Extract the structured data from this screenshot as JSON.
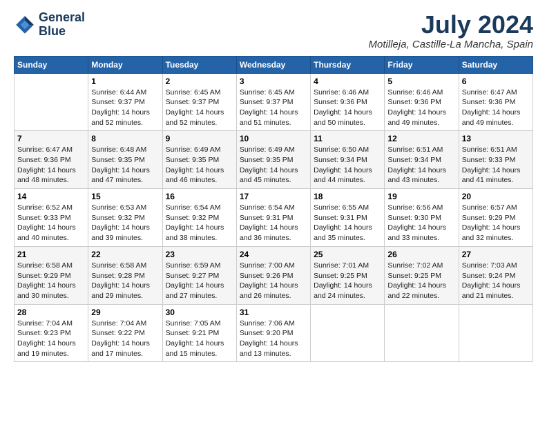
{
  "logo": {
    "line1": "General",
    "line2": "Blue"
  },
  "title": "July 2024",
  "subtitle": "Motilleja, Castille-La Mancha, Spain",
  "weekdays": [
    "Sunday",
    "Monday",
    "Tuesday",
    "Wednesday",
    "Thursday",
    "Friday",
    "Saturday"
  ],
  "weeks": [
    [
      {
        "day": "",
        "sunrise": "",
        "sunset": "",
        "daylight": ""
      },
      {
        "day": "1",
        "sunrise": "Sunrise: 6:44 AM",
        "sunset": "Sunset: 9:37 PM",
        "daylight": "Daylight: 14 hours and 52 minutes."
      },
      {
        "day": "2",
        "sunrise": "Sunrise: 6:45 AM",
        "sunset": "Sunset: 9:37 PM",
        "daylight": "Daylight: 14 hours and 52 minutes."
      },
      {
        "day": "3",
        "sunrise": "Sunrise: 6:45 AM",
        "sunset": "Sunset: 9:37 PM",
        "daylight": "Daylight: 14 hours and 51 minutes."
      },
      {
        "day": "4",
        "sunrise": "Sunrise: 6:46 AM",
        "sunset": "Sunset: 9:36 PM",
        "daylight": "Daylight: 14 hours and 50 minutes."
      },
      {
        "day": "5",
        "sunrise": "Sunrise: 6:46 AM",
        "sunset": "Sunset: 9:36 PM",
        "daylight": "Daylight: 14 hours and 49 minutes."
      },
      {
        "day": "6",
        "sunrise": "Sunrise: 6:47 AM",
        "sunset": "Sunset: 9:36 PM",
        "daylight": "Daylight: 14 hours and 49 minutes."
      }
    ],
    [
      {
        "day": "7",
        "sunrise": "Sunrise: 6:47 AM",
        "sunset": "Sunset: 9:36 PM",
        "daylight": "Daylight: 14 hours and 48 minutes."
      },
      {
        "day": "8",
        "sunrise": "Sunrise: 6:48 AM",
        "sunset": "Sunset: 9:35 PM",
        "daylight": "Daylight: 14 hours and 47 minutes."
      },
      {
        "day": "9",
        "sunrise": "Sunrise: 6:49 AM",
        "sunset": "Sunset: 9:35 PM",
        "daylight": "Daylight: 14 hours and 46 minutes."
      },
      {
        "day": "10",
        "sunrise": "Sunrise: 6:49 AM",
        "sunset": "Sunset: 9:35 PM",
        "daylight": "Daylight: 14 hours and 45 minutes."
      },
      {
        "day": "11",
        "sunrise": "Sunrise: 6:50 AM",
        "sunset": "Sunset: 9:34 PM",
        "daylight": "Daylight: 14 hours and 44 minutes."
      },
      {
        "day": "12",
        "sunrise": "Sunrise: 6:51 AM",
        "sunset": "Sunset: 9:34 PM",
        "daylight": "Daylight: 14 hours and 43 minutes."
      },
      {
        "day": "13",
        "sunrise": "Sunrise: 6:51 AM",
        "sunset": "Sunset: 9:33 PM",
        "daylight": "Daylight: 14 hours and 41 minutes."
      }
    ],
    [
      {
        "day": "14",
        "sunrise": "Sunrise: 6:52 AM",
        "sunset": "Sunset: 9:33 PM",
        "daylight": "Daylight: 14 hours and 40 minutes."
      },
      {
        "day": "15",
        "sunrise": "Sunrise: 6:53 AM",
        "sunset": "Sunset: 9:32 PM",
        "daylight": "Daylight: 14 hours and 39 minutes."
      },
      {
        "day": "16",
        "sunrise": "Sunrise: 6:54 AM",
        "sunset": "Sunset: 9:32 PM",
        "daylight": "Daylight: 14 hours and 38 minutes."
      },
      {
        "day": "17",
        "sunrise": "Sunrise: 6:54 AM",
        "sunset": "Sunset: 9:31 PM",
        "daylight": "Daylight: 14 hours and 36 minutes."
      },
      {
        "day": "18",
        "sunrise": "Sunrise: 6:55 AM",
        "sunset": "Sunset: 9:31 PM",
        "daylight": "Daylight: 14 hours and 35 minutes."
      },
      {
        "day": "19",
        "sunrise": "Sunrise: 6:56 AM",
        "sunset": "Sunset: 9:30 PM",
        "daylight": "Daylight: 14 hours and 33 minutes."
      },
      {
        "day": "20",
        "sunrise": "Sunrise: 6:57 AM",
        "sunset": "Sunset: 9:29 PM",
        "daylight": "Daylight: 14 hours and 32 minutes."
      }
    ],
    [
      {
        "day": "21",
        "sunrise": "Sunrise: 6:58 AM",
        "sunset": "Sunset: 9:29 PM",
        "daylight": "Daylight: 14 hours and 30 minutes."
      },
      {
        "day": "22",
        "sunrise": "Sunrise: 6:58 AM",
        "sunset": "Sunset: 9:28 PM",
        "daylight": "Daylight: 14 hours and 29 minutes."
      },
      {
        "day": "23",
        "sunrise": "Sunrise: 6:59 AM",
        "sunset": "Sunset: 9:27 PM",
        "daylight": "Daylight: 14 hours and 27 minutes."
      },
      {
        "day": "24",
        "sunrise": "Sunrise: 7:00 AM",
        "sunset": "Sunset: 9:26 PM",
        "daylight": "Daylight: 14 hours and 26 minutes."
      },
      {
        "day": "25",
        "sunrise": "Sunrise: 7:01 AM",
        "sunset": "Sunset: 9:25 PM",
        "daylight": "Daylight: 14 hours and 24 minutes."
      },
      {
        "day": "26",
        "sunrise": "Sunrise: 7:02 AM",
        "sunset": "Sunset: 9:25 PM",
        "daylight": "Daylight: 14 hours and 22 minutes."
      },
      {
        "day": "27",
        "sunrise": "Sunrise: 7:03 AM",
        "sunset": "Sunset: 9:24 PM",
        "daylight": "Daylight: 14 hours and 21 minutes."
      }
    ],
    [
      {
        "day": "28",
        "sunrise": "Sunrise: 7:04 AM",
        "sunset": "Sunset: 9:23 PM",
        "daylight": "Daylight: 14 hours and 19 minutes."
      },
      {
        "day": "29",
        "sunrise": "Sunrise: 7:04 AM",
        "sunset": "Sunset: 9:22 PM",
        "daylight": "Daylight: 14 hours and 17 minutes."
      },
      {
        "day": "30",
        "sunrise": "Sunrise: 7:05 AM",
        "sunset": "Sunset: 9:21 PM",
        "daylight": "Daylight: 14 hours and 15 minutes."
      },
      {
        "day": "31",
        "sunrise": "Sunrise: 7:06 AM",
        "sunset": "Sunset: 9:20 PM",
        "daylight": "Daylight: 14 hours and 13 minutes."
      },
      {
        "day": "",
        "sunrise": "",
        "sunset": "",
        "daylight": ""
      },
      {
        "day": "",
        "sunrise": "",
        "sunset": "",
        "daylight": ""
      },
      {
        "day": "",
        "sunrise": "",
        "sunset": "",
        "daylight": ""
      }
    ]
  ]
}
